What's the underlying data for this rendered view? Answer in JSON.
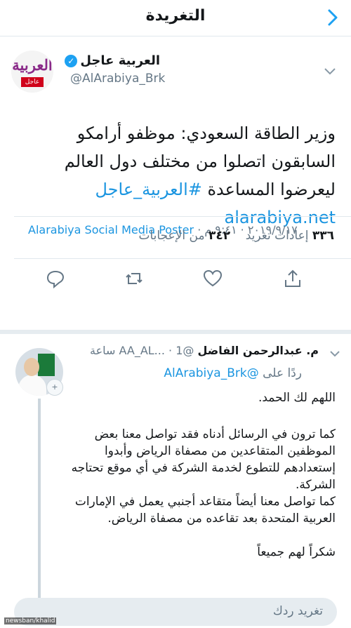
{
  "header": {
    "title": "التغريدة"
  },
  "tweet": {
    "author_name": "العربية عاجل",
    "author_handle": "@AlArabiya_Brk",
    "avatar_brand": "العربية",
    "avatar_tag": "عاجل",
    "text_main": "وزير الطاقة السعودي: موظفو أرامكو السابقون اتصلوا من مختلف دول العالم ليعرضوا المساعدة ",
    "hashtag": "#العربية_عاجل",
    "link": "alarabiya.net",
    "time": "٩:٤١ م",
    "date": "٢٠١٩/٩/١٧",
    "source": "Alarabiya Social Media Poster",
    "retweets_count": "٣٣٦",
    "retweets_label": "إعادات تغريد",
    "likes_count": "٣٤٢",
    "likes_label": "من الإعجابات"
  },
  "reply": {
    "author_name": "م. عبدالرحمن الفاضل",
    "author_handle": "@AA_AL...",
    "time": "1 ساعة",
    "replying_to_label": "ردًا على",
    "replying_to_handle": "@AlArabiya_Brk",
    "p1": "اللهم لك الحمد.",
    "p2": "كما ترون في الرسائل أدناه فقد تواصل معنا بعض الموظفين المتقاعدين من مصفاة الرياض وأبدوا إستعدادهم للتطوع لخدمة الشركة في أي موقع تحتاجه الشركة.",
    "p3": "كما تواصل معنا أيضاً متقاعد أجنبي يعمل في الإمارات العربية المتحدة بعد تقاعده من مصفاة الرياض.",
    "p4": "شكراً لهم جميعاً"
  },
  "composer": {
    "placeholder": "تغريد ردك"
  },
  "watermark": "newsban/khalid",
  "colors": {
    "accent": "#1da1f2",
    "link": "#1b95e0",
    "muted": "#657786",
    "divider": "#e1e8ed"
  }
}
